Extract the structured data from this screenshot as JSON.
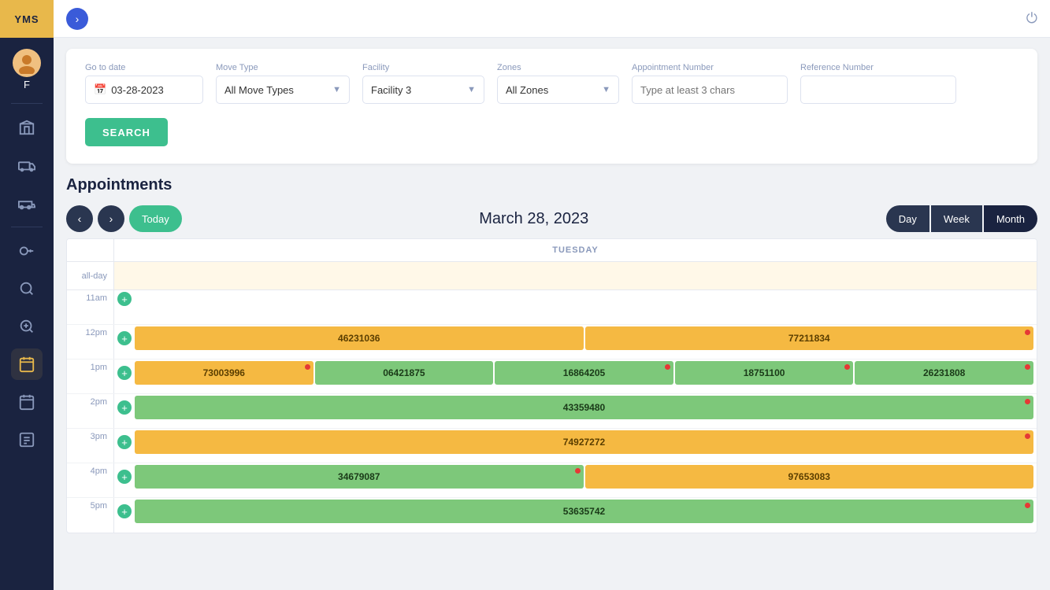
{
  "sidebar": {
    "logo": "YMS",
    "user_letter": "F",
    "icons": [
      {
        "name": "building-icon",
        "symbol": "🏛",
        "active": false
      },
      {
        "name": "truck-icon",
        "symbol": "🚛",
        "active": false
      },
      {
        "name": "truck2-icon",
        "symbol": "🚚",
        "active": false
      },
      {
        "name": "key-icon",
        "symbol": "🔑",
        "active": false
      },
      {
        "name": "search1-icon",
        "symbol": "🔍",
        "active": false
      },
      {
        "name": "search2-icon",
        "symbol": "🔎",
        "active": false
      },
      {
        "name": "calendar-icon",
        "symbol": "📅",
        "active": true
      },
      {
        "name": "calendar2-icon",
        "symbol": "📆",
        "active": false
      },
      {
        "name": "list-icon",
        "symbol": "📋",
        "active": false
      }
    ]
  },
  "topbar": {
    "expand_icon": "›",
    "power_icon": "⏻"
  },
  "search": {
    "go_to_date_label": "Go to date",
    "go_to_date_value": "03-28-2023",
    "move_type_label": "Move Type",
    "move_type_value": "All Move Types",
    "facility_label": "Facility",
    "facility_value": "Facility 3",
    "zones_label": "Zones",
    "zones_value": "All Zones",
    "appt_number_label": "Appointment Number",
    "appt_number_placeholder": "Type at least 3 chars",
    "ref_number_label": "Reference Number",
    "ref_number_placeholder": "",
    "search_btn": "SEARCH"
  },
  "appointments": {
    "title": "Appointments",
    "date_display": "March 28, 2023",
    "day_label": "TUESDAY",
    "view_buttons": [
      "Day",
      "Week",
      "Month"
    ],
    "active_view": "Day",
    "time_rows": [
      {
        "time": "11am",
        "events": []
      },
      {
        "time": "12pm",
        "events": [
          {
            "id": "46231036",
            "color": "orange",
            "flex": 1,
            "dot": false
          },
          {
            "id": "77211834",
            "color": "orange",
            "flex": 1,
            "dot": true
          }
        ]
      },
      {
        "time": "1pm",
        "events": [
          {
            "id": "73003996",
            "color": "orange",
            "flex": 0.5,
            "dot": true
          },
          {
            "id": "06421875",
            "color": "green",
            "flex": 0.5,
            "dot": false
          },
          {
            "id": "16864205",
            "color": "green",
            "flex": 0.5,
            "dot": true
          },
          {
            "id": "18751100",
            "color": "green",
            "flex": 0.5,
            "dot": true
          },
          {
            "id": "26231808",
            "color": "green",
            "flex": 0.5,
            "dot": true
          }
        ]
      },
      {
        "time": "2pm",
        "events": [
          {
            "id": "43359480",
            "color": "green",
            "flex": 1,
            "dot": true
          }
        ]
      },
      {
        "time": "3pm",
        "events": [
          {
            "id": "74927272",
            "color": "orange",
            "flex": 1,
            "dot": true
          }
        ]
      },
      {
        "time": "4pm",
        "events": [
          {
            "id": "34679087",
            "color": "green",
            "flex": 1,
            "dot": true
          },
          {
            "id": "97653083",
            "color": "orange",
            "flex": 1,
            "dot": false
          }
        ]
      },
      {
        "time": "5pm",
        "events": [
          {
            "id": "53635742",
            "color": "green",
            "flex": 1,
            "dot": true
          }
        ]
      }
    ]
  }
}
